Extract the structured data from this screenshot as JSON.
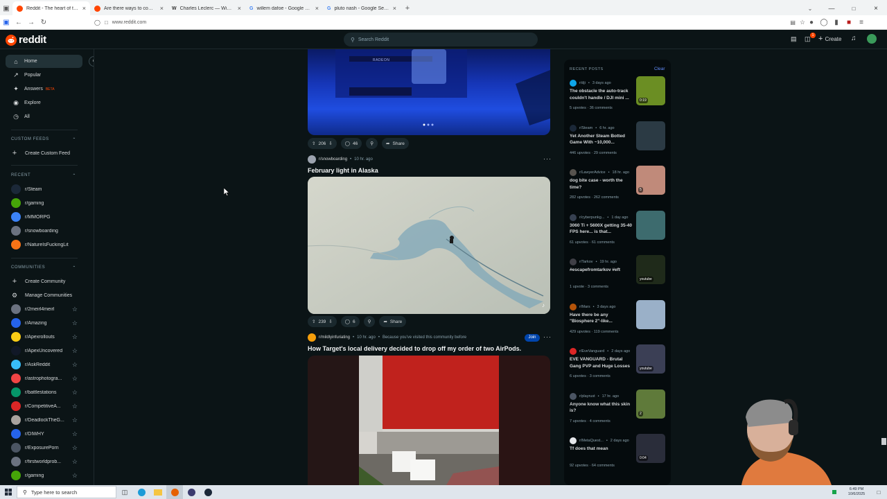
{
  "browser": {
    "tabs": [
      {
        "title": "Reddit - The heart of the internet",
        "icon_color": "#ff4500",
        "active": true
      },
      {
        "title": "Are there ways to combat light",
        "icon_color": "#ff4500",
        "active": false
      },
      {
        "title": "Charles Leclerc — Wikipedia",
        "icon": "W",
        "icon_color": "#555555",
        "active": false
      },
      {
        "title": "willem dafoe - Google Search",
        "icon": "G",
        "icon_color": "#4285f4",
        "active": false
      },
      {
        "title": "pluto nash - Google Search",
        "icon": "G",
        "icon_color": "#4285f4",
        "active": false
      }
    ],
    "tab_icon_w": "W",
    "tab_icon_g": "G",
    "new_tab": "+",
    "url": "www.reddit.com",
    "icons": [
      "sidebar-icon",
      "back-icon",
      "forward-icon",
      "reload-icon",
      "shield-icon",
      "lock-icon",
      "reader-icon",
      "bookmark-star-icon",
      "extension-icon",
      "account-icon",
      "menu-icon"
    ]
  },
  "header": {
    "logo_text": "reddit",
    "search_placeholder": "Search Reddit",
    "create_label": "Create",
    "chat_badge": "1"
  },
  "leftnav": {
    "primary": [
      {
        "label": "Home",
        "icon": "home-icon"
      },
      {
        "label": "Popular",
        "icon": "popular-icon"
      },
      {
        "label": "Answers",
        "badge": "BETA",
        "icon": "answers-icon"
      },
      {
        "label": "Explore",
        "icon": "explore-icon"
      },
      {
        "label": "All",
        "icon": "all-icon"
      }
    ],
    "custom_feeds_title": "CUSTOM FEEDS",
    "create_custom_feed": "Create Custom Feed",
    "recent_title": "RECENT",
    "recent": [
      {
        "name": "r/Steam",
        "color": "#1b2838"
      },
      {
        "name": "r/gaming",
        "color": "#46a508"
      },
      {
        "name": "r/MMORPG",
        "color": "#3b82f6"
      },
      {
        "name": "r/snowboarding",
        "color": "#6b7280"
      },
      {
        "name": "r/NatureIsFuckingLit",
        "color": "#f97316"
      }
    ],
    "communities_title": "COMMUNITIES",
    "create_community": "Create Community",
    "manage_communities": "Manage Communities",
    "communities": [
      {
        "name": "r/2meirl4meirl",
        "color": "#6b7280"
      },
      {
        "name": "r/Amazing",
        "color": "#2563eb"
      },
      {
        "name": "r/Apexrollouts",
        "color": "#facc15"
      },
      {
        "name": "r/ApexUncovered",
        "color": "#111827"
      },
      {
        "name": "r/AskReddit",
        "color": "#38bdf8"
      },
      {
        "name": "r/astrophotogra...",
        "color": "#ef4444"
      },
      {
        "name": "r/battlestations",
        "color": "#059669"
      },
      {
        "name": "r/CompetitiveA...",
        "color": "#dc2626"
      },
      {
        "name": "r/DeadlockTheG...",
        "color": "#a8a29e"
      },
      {
        "name": "r/DIWHY",
        "color": "#2563eb"
      },
      {
        "name": "r/ExposurePorn",
        "color": "#4b5563"
      },
      {
        "name": "r/firstworldprob...",
        "color": "#6b7280"
      },
      {
        "name": "r/gaming",
        "color": "#46a508"
      }
    ]
  },
  "feed": {
    "post0": {
      "upvotes": "206",
      "comments": "46",
      "share": "Share",
      "image_text": "RADEON"
    },
    "post1": {
      "subreddit": "r/snowboarding",
      "time": "10 hr. ago",
      "title": "February light in Alaska",
      "upvotes": "239",
      "comments": "6",
      "share": "Share"
    },
    "post2": {
      "subreddit": "r/mildlyinfuriating",
      "time": "10 hr. ago",
      "reason": "Because you've visited this community before",
      "join": "Join",
      "title": "How Target's local delivery decided to drop off my order of two AirPods."
    }
  },
  "recent_posts": {
    "title": "RECENT POSTS",
    "clear": "Clear",
    "items": [
      {
        "sub": "r/dji",
        "time": "3 days ago",
        "title": "The obstacle the auto-track couldn't handle / DJI mini ...",
        "upvotes": "5 upvotes",
        "comments": "36 comments",
        "badge": "0:19",
        "av": "#0ea5e9",
        "thumb": "#6b8e23"
      },
      {
        "sub": "r/Steam",
        "time": "6 hr. ago",
        "title": "Yet Another Steam Botted Game With ~10,000...",
        "upvotes": "446 upvotes",
        "comments": "29 comments",
        "badge": "",
        "av": "#1b2838",
        "thumb": "#2b3a44"
      },
      {
        "sub": "r/LawyerAdvice",
        "time": "18 hr. ago",
        "title": "dog bite case - worth the time?",
        "upvotes": "282 upvotes",
        "comments": "262 comments",
        "badge": "5",
        "av": "#57534e",
        "thumb": "#c08a7a"
      },
      {
        "sub": "r/cyberpunkg...",
        "time": "1 day ago",
        "title": "3060 Ti + 5600X getting 35-40 FPS here... is that...",
        "upvotes": "61 upvotes",
        "comments": "61 comments",
        "badge": "",
        "av": "#374151",
        "thumb": "#3d6b6e"
      },
      {
        "sub": "r/Tarkov",
        "time": "19 hr. ago",
        "title": "#escapefromtarkov #eft",
        "upvotes": "1 upvote",
        "comments": "3 comments",
        "badge": "youtube",
        "av": "#3f3f46",
        "thumb": "#1f2a1a"
      },
      {
        "sub": "r/Mars",
        "time": "3 days ago",
        "title": "Have there be any \"Biosphere 2\"-like...",
        "upvotes": "429 upvotes",
        "comments": "119 comments",
        "badge": "",
        "av": "#b45309",
        "thumb": "#9ab0c8"
      },
      {
        "sub": "r/EveVanguard",
        "time": "2 days ago",
        "title": "EVE VANGUARD - Brutal Gang PVP and Huge Losses",
        "upvotes": "6 upvotes",
        "comments": "3 comments",
        "badge": "youtube",
        "av": "#dc2626",
        "thumb": "#3b3f55"
      },
      {
        "sub": "r/playrust",
        "time": "17 hr. ago",
        "title": "Anyone know what this skin is?",
        "upvotes": "7 upvotes",
        "comments": "4 comments",
        "badge": "2",
        "av": "#4b5563",
        "thumb": "#5f7a3a"
      },
      {
        "sub": "r/MetaQuest...",
        "time": "2 days ago",
        "title": "Tf does that mean",
        "upvotes": "92 upvotes",
        "comments": "64 comments",
        "badge": "0:04",
        "av": "#e5e7eb",
        "thumb": "#2a2d3a"
      }
    ]
  },
  "taskbar": {
    "search_placeholder": "Type here to search",
    "time": "6:49 PM",
    "date": "10/6/2025"
  },
  "colors": {
    "bg": "#0b1416",
    "accent": "#ff4500",
    "join": "#0045ac",
    "panel": "#050b0d"
  }
}
